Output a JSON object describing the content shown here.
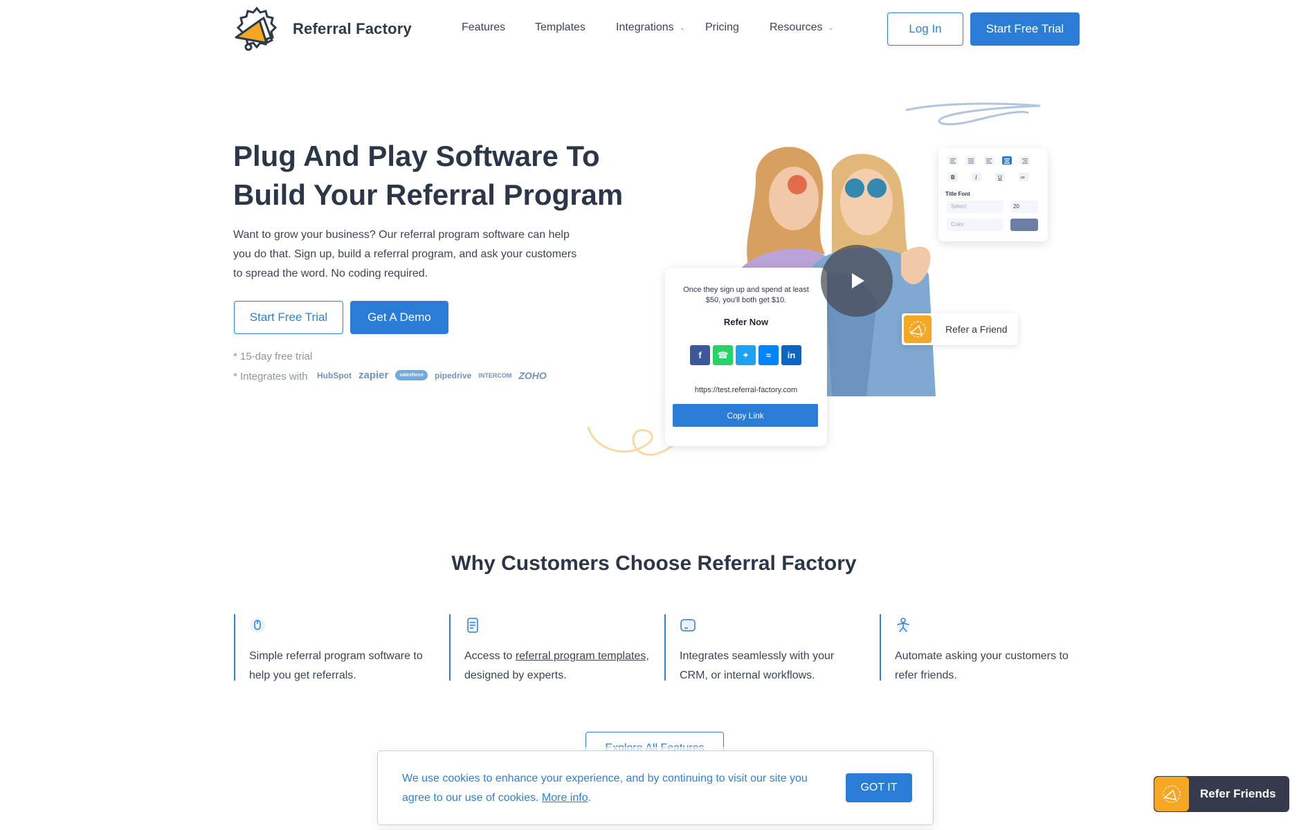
{
  "header": {
    "brand": "Referral Factory",
    "nav": [
      {
        "label": "Features"
      },
      {
        "label": "Templates"
      },
      {
        "label": "Integrations"
      },
      {
        "label": "Pricing"
      },
      {
        "label": "Resources"
      }
    ],
    "login_label": "Log In",
    "trial_label": "Start Free Trial"
  },
  "hero": {
    "title": "Plug And Play Software To Build Your Referral Program",
    "subtitle": "Want to grow your business? Our referral program software can help you do that. Sign up, build a referral program, and ask your customers to spread the word. No coding required.",
    "trial_label": "Start Free Trial",
    "demo_label": "Get A Demo",
    "note_trial": "* 15-day free trial",
    "note_integrates": "* Integrates with",
    "integrations": [
      "HubSpot",
      "zapier",
      "salesforce",
      "pipedrive",
      "INTERCOM",
      "ZOHO"
    ]
  },
  "mockup": {
    "editor_title_font": "Title Font",
    "editor_select": "Select",
    "editor_size": "20",
    "editor_color": "Color",
    "share_text": "Once they sign up and spend at least $50, you'll both get $10.",
    "refer_now": "Refer Now",
    "share_url": "https://test.referral-factory.com",
    "copy_link": "Copy Link",
    "refer_friend": "Refer a Friend"
  },
  "why": {
    "title": "Why Customers Choose Referral Factory",
    "features": [
      {
        "text": "Simple referral program software to help you get referrals."
      },
      {
        "prefix": "Access to ",
        "link": "referral program templates,",
        "suffix": " designed by experts."
      },
      {
        "text": "Integrates seamlessly with your CRM, or internal workflows."
      },
      {
        "text": "Automate asking your customers to refer friends."
      }
    ],
    "explore_label": "Explore All Features"
  },
  "cookie": {
    "text": "We use cookies to enhance your experience, and by continuing to visit our site you agree to our use of cookies.",
    "more_info": "More info",
    "period": ".",
    "got_it": "GOT IT"
  },
  "widget": {
    "label": "Refer Friends"
  },
  "colors": {
    "accent": "#2a7cd7",
    "brand_orange": "#f5a623",
    "heading": "#2b3648"
  }
}
